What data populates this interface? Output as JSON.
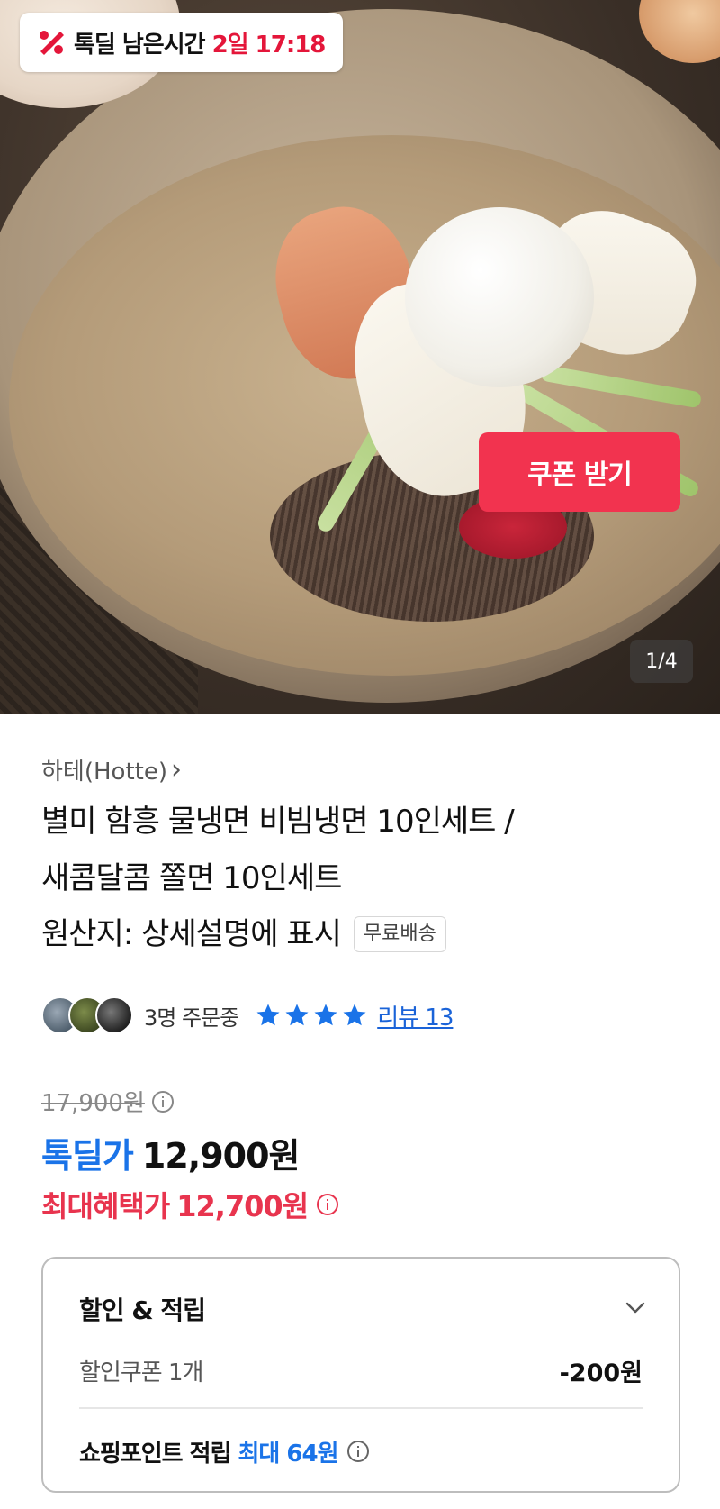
{
  "deal_timer": {
    "label": "톡딜 남은시간",
    "value": "2일 17:18",
    "icon": "discount-percent-icon",
    "accent_color": "#e4163a"
  },
  "gallery": {
    "counter": "1/4"
  },
  "product": {
    "seller": "하테(Hotte)",
    "seller_chevron": "›",
    "title_lines": [
      "별미 함흥 물냉면 비빔냉면 10인세트 /",
      "새콤달콤 쫄면 10인세트",
      "원산지: 상세설명에 표시"
    ],
    "shipping_badge": "무료배송"
  },
  "social": {
    "buyers_text": "3명 주문중",
    "rating_stars": 4,
    "review_link": "리뷰 13",
    "star_color": "#1a73e8"
  },
  "pricing": {
    "original_price": "17,900원",
    "deal_label": "톡딜가",
    "deal_price": "12,900원",
    "best_label": "최대혜택가",
    "best_price": "12,700원",
    "coupon_button": "쿠폰 받기",
    "deal_color": "#1a73e8",
    "best_color": "#e8344e",
    "button_color": "#f2334f"
  },
  "benefits": {
    "title": "할인 & 적립",
    "coupon_name": "할인쿠폰 1개",
    "coupon_amount": "-200원",
    "points_label": "쇼핑포인트 적립",
    "points_value": "최대 64원"
  }
}
